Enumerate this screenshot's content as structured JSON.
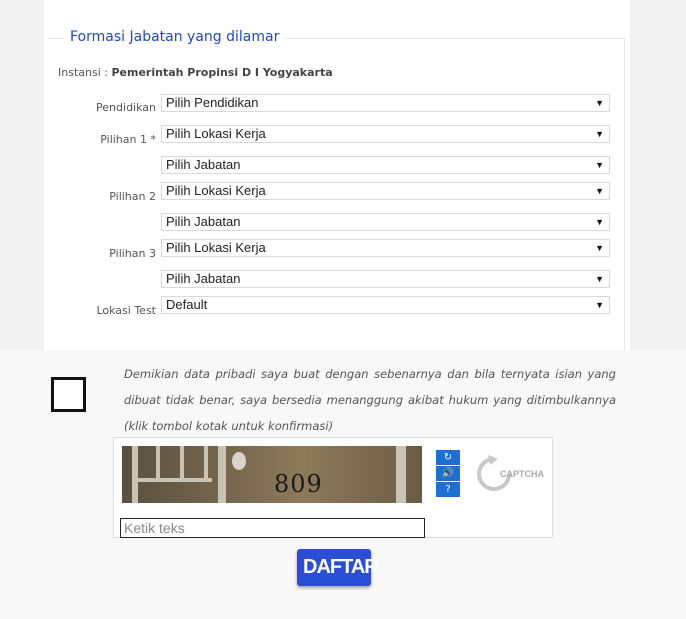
{
  "section": {
    "legend": "Formasi Jabatan yang dilamar",
    "instansi_label": "Instansi :",
    "instansi_value": "Pemerintah Propinsi D I Yogyakarta"
  },
  "form": {
    "pendidikan_label": "Pendidikan",
    "pendidikan_value": "Pilih Pendidikan",
    "pilihan1_label": "Pilihan 1 *",
    "pilihan1_lokasi": "Pilih Lokasi Kerja",
    "pilihan1_jabatan": "Pilih Jabatan",
    "pilihan2_label": "Pilihan 2",
    "pilihan2_lokasi": "Pilih Lokasi Kerja",
    "pilihan2_jabatan": "Pilih Jabatan",
    "pilihan3_label": "Pilihan 3",
    "pilihan3_lokasi": "Pilih Lokasi Kerja",
    "pilihan3_jabatan": "Pilih Jabatan",
    "lokasi_test_label": "Lokasi Test",
    "lokasi_test_value": "Default",
    "dropdown_arrow": "▼"
  },
  "declaration": {
    "text": "Demikian data pribadi saya buat dengan sebenarnya dan bila ternyata isian yang dibuat tidak benar, saya bersedia menanggung akibat hukum yang ditimbulkannya (klik tombol kotak untuk konfirmasi)"
  },
  "captcha": {
    "image_digits": "809",
    "input_placeholder": "Ketik teks",
    "logo_text": "CAPTCHA",
    "icons": [
      "refresh-icon",
      "audio-icon",
      "help-icon"
    ]
  },
  "submit": {
    "label": "DAFTAR",
    "color": "#2a4fd6"
  },
  "colors": {
    "legend": "#1f47c9",
    "captcha_buttons": "#1d6fd3"
  }
}
